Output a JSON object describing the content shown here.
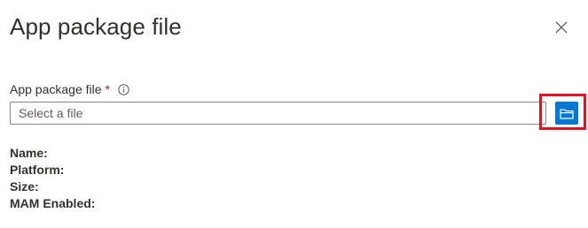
{
  "panel": {
    "title": "App package file",
    "close_icon": "close-icon"
  },
  "field": {
    "label": "App package file",
    "required_marker": "*",
    "info_icon": "info-icon",
    "placeholder": "Select a file",
    "value": "",
    "browse_icon": "folder-open-icon"
  },
  "details": {
    "name_label": "Name:",
    "platform_label": "Platform:",
    "size_label": "Size:",
    "mam_label": "MAM Enabled:"
  },
  "colors": {
    "accent": "#0078d4",
    "highlight": "#e81123",
    "required": "#a4262c",
    "text": "#323130"
  }
}
